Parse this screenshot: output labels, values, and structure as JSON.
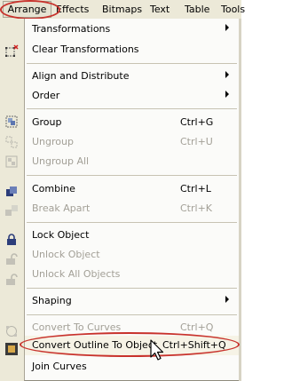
{
  "menubar": {
    "items": [
      "Arrange",
      "Effects",
      "Bitmaps",
      "Text",
      "Table",
      "Tools"
    ]
  },
  "menu": {
    "items": [
      {
        "label": "Transformations",
        "submenu": true
      },
      {
        "label": "Clear Transformations"
      },
      {
        "label": "Align and Distribute",
        "submenu": true
      },
      {
        "label": "Order",
        "submenu": true
      },
      {
        "label": "Group",
        "shortcut": "Ctrl+G"
      },
      {
        "label": "Ungroup",
        "shortcut": "Ctrl+U",
        "disabled": true
      },
      {
        "label": "Ungroup All",
        "disabled": true
      },
      {
        "label": "Combine",
        "shortcut": "Ctrl+L"
      },
      {
        "label": "Break Apart",
        "shortcut": "Ctrl+K",
        "disabled": true
      },
      {
        "label": "Lock Object"
      },
      {
        "label": "Unlock Object",
        "disabled": true
      },
      {
        "label": "Unlock All Objects",
        "disabled": true
      },
      {
        "label": "Shaping",
        "submenu": true
      },
      {
        "label": "Convert To Curves",
        "shortcut": "Ctrl+Q",
        "disabled": true
      },
      {
        "label": "Convert Outline To Object",
        "shortcut": "Ctrl+Shift+Q",
        "highlighted": true
      },
      {
        "label": "Join Curves"
      }
    ]
  },
  "colors": {
    "annotation_ring": "#c8322c",
    "disabled_text": "#a3a097"
  }
}
